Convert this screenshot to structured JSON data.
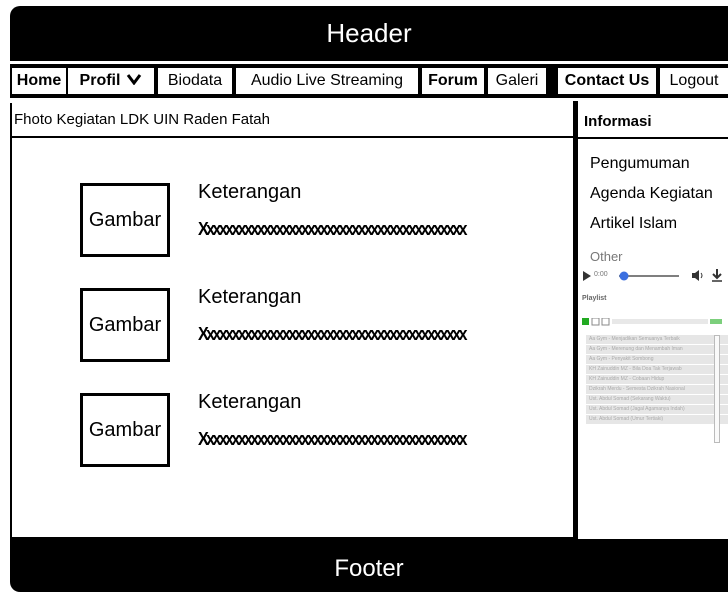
{
  "header": {
    "title": "Header"
  },
  "nav": {
    "items": [
      {
        "label": "Home"
      },
      {
        "label": "Profil"
      },
      {
        "label": "Biodata"
      },
      {
        "label": "Audio Live Streaming"
      },
      {
        "label": "Forum"
      },
      {
        "label": "Galeri"
      },
      {
        "label": "Contact Us"
      },
      {
        "label": "Logout"
      }
    ]
  },
  "main": {
    "title": "Fhoto Kegiatan LDK UIN Raden Fatah",
    "gallery": [
      {
        "image_label": "Gambar",
        "caption": "Keterangan",
        "text": "Xxxxxxxxxxxxxxxxxxxxxxxxxxxxxxxxxxxxxxxxxx"
      },
      {
        "image_label": "Gambar",
        "caption": "Keterangan",
        "text": "Xxxxxxxxxxxxxxxxxxxxxxxxxxxxxxxxxxxxxxxxxx"
      },
      {
        "image_label": "Gambar",
        "caption": "Keterangan",
        "text": "Xxxxxxxxxxxxxxxxxxxxxxxxxxxxxxxxxxxxxxxxxx"
      }
    ]
  },
  "sidebar": {
    "title": "Informasi",
    "links": [
      {
        "label": "Pengumuman"
      },
      {
        "label": "Agenda Kegiatan"
      },
      {
        "label": "Artikel Islam"
      }
    ],
    "other": "Other",
    "player": {
      "time": "0:00",
      "volume_level": 0.2
    },
    "playlist_title": "Playlist",
    "playlist": [
      "Aa Gym - Menjadikan Semuanya Terbaik",
      "Aa Gym - Merenung dan Menambah Iman",
      "Aa Gym - Penyakit Sombong",
      "KH Zainuddin MZ - Bila Doa Tak Terjawab",
      "KH Zainuddin MZ - Cobaan Hidup",
      "Dzikrah Merdu - Semesta Dzikrah Nasional",
      "Ust. Abdul Somad (Sekarang Waktu)",
      "Ust. Abdul Somad (Jagal Agamanya Indah)",
      "Ust. Abdul Somad (Umur Tertiaki)"
    ]
  },
  "footer": {
    "title": "Footer"
  },
  "colors": {
    "bar": "#000000",
    "text_light": "#ffffff",
    "muted": "#777777",
    "accent": "#22aa22",
    "slider": "#3b6fe0"
  }
}
